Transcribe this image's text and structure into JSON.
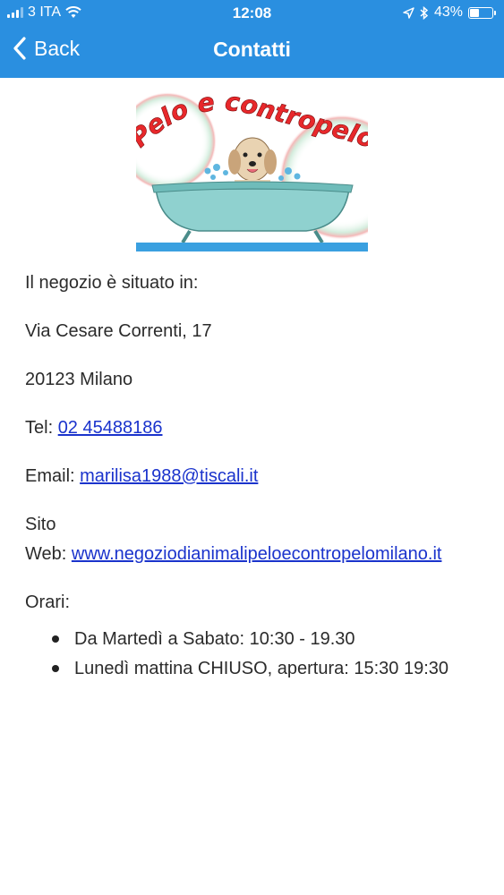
{
  "status_bar": {
    "carrier": "3 ITA",
    "time": "12:08",
    "battery_percent": "43%",
    "battery_level": 0.43,
    "icons": [
      "signal-icon",
      "wifi-icon",
      "location-arrow-icon",
      "bluetooth-icon",
      "battery-icon"
    ]
  },
  "navbar": {
    "back_label": "Back",
    "title": "Contatti",
    "background_color": "#2a8fe0"
  },
  "logo": {
    "text": "Pelo e contropelo"
  },
  "content": {
    "location_intro": "Il negozio è situato in:",
    "address_street": "Via Cesare Correnti, 17",
    "address_city": "20123 Milano",
    "tel_label": "Tel: ",
    "tel_value": "02 45488186",
    "email_label": "Email: ",
    "email_value": "marilisa1988@tiscali.it",
    "site_label_1": "Sito",
    "site_label_2": "Web: ",
    "site_value": "www.negoziodianimalipeloecontropelomilano.it",
    "hours_label": "Orari:",
    "hours": [
      "Da Martedì a Sabato: 10:30 - 19.30",
      "Lunedì mattina CHIUSO, apertura: 15:30 19:30"
    ],
    "link_color": "#1a33cc"
  }
}
